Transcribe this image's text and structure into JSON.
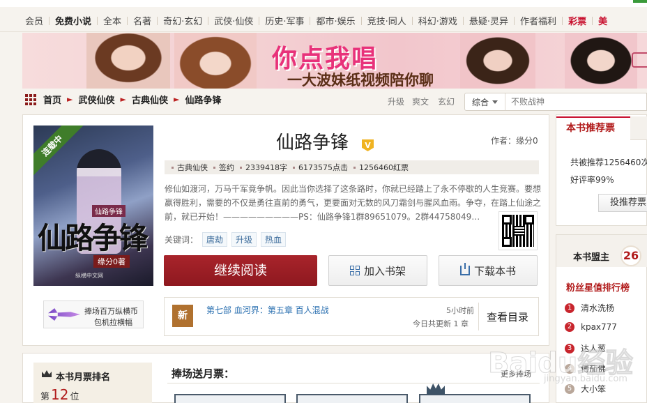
{
  "topnav": {
    "items": [
      {
        "label": "会员",
        "style": "normal"
      },
      {
        "label": "免费小说",
        "style": "bold"
      },
      {
        "label": "全本",
        "style": "normal"
      },
      {
        "label": "名著",
        "style": "normal"
      },
      {
        "label": "奇幻·玄幻",
        "style": "normal"
      },
      {
        "label": "武侠·仙侠",
        "style": "normal"
      },
      {
        "label": "历史·军事",
        "style": "normal"
      },
      {
        "label": "都市·娱乐",
        "style": "normal"
      },
      {
        "label": "竞技·同人",
        "style": "normal"
      },
      {
        "label": "科幻·游戏",
        "style": "normal"
      },
      {
        "label": "悬疑·灵异",
        "style": "normal"
      },
      {
        "label": "作者福利",
        "style": "normal"
      },
      {
        "label": "彩票",
        "style": "red"
      },
      {
        "label": "美",
        "style": "red"
      }
    ]
  },
  "banner": {
    "headline": "你点我唱",
    "subline": "一大波妹纸视频陪你聊"
  },
  "breadcrumb": {
    "items": [
      "首页",
      "武侠仙侠",
      "古典仙侠",
      "仙路争锋"
    ]
  },
  "quicklinks": [
    "升级",
    "爽文",
    "玄幻"
  ],
  "search": {
    "scope": "综合",
    "placeholder": "不败战神"
  },
  "book": {
    "cover_ribbon": "连载中",
    "cover_title": "仙路争锋",
    "cover_small_title": "仙路争锋",
    "cover_author": "缘分0著",
    "cover_publisher": "纵横中文网",
    "title": "仙路争锋",
    "vip_badge": "V",
    "author_label": "作者：缘分0",
    "meta": [
      "古典仙侠",
      "签约",
      "2339418字",
      "6173575点击",
      "1256460红票"
    ],
    "description": "修仙如渡河，万马千军竟争帆。因此当你选择了这条路时，你就已经踏上了永不停歇的人生竞赛。要想赢得胜利，需要的不仅是勇往直前的勇气，更要面对无数的风刀霜剑与腥风血雨。争夺，在踏上仙途之前，就已开始！—————————PS：仙路争锋1群89651079。2群44758049…",
    "keywords_label": "关键词：",
    "keywords": [
      "唐劫",
      "升级",
      "热血"
    ]
  },
  "actions": {
    "read": "继续阅读",
    "shelf": "加入书架",
    "download": "下载本书"
  },
  "promo": {
    "line1": "捧场百万纵横币",
    "line2": "包机拉横幅"
  },
  "latest": {
    "tag": "新",
    "chapter": "第七部  血河界：第五章  百人混战",
    "time": "5小时前",
    "today": "今日共更新 1 章",
    "catalog": "查看目录"
  },
  "recommend": {
    "tab": "本书推荐票",
    "total": "共被推荐1256460次",
    "rating": "好评率99%",
    "vote_button": "投推荐票"
  },
  "mengzhu": {
    "label": "本书盟主",
    "count": "26",
    "fans_title": "粉丝星值排行榜",
    "fans": [
      {
        "rank": "1",
        "name": "清水洗杨"
      },
      {
        "rank": "2",
        "name": "kpax777"
      },
      {
        "rank": "3",
        "name": "达人葱"
      },
      {
        "rank": "4",
        "name": "傅茄佛"
      },
      {
        "rank": "5",
        "name": "大小笨"
      }
    ]
  },
  "monthly": {
    "title": "本书月票排名",
    "rank_prefix": "第",
    "rank": "12",
    "rank_suffix": "位",
    "support_title": "捧场送月票：",
    "more": "更多捧场"
  },
  "watermark": {
    "logo": "Baidu经验",
    "url": "jingyan.baidu.com"
  }
}
